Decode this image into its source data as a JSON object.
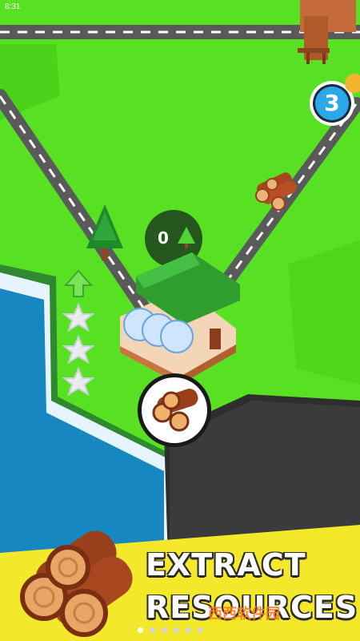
{
  "status_bar": {
    "time": "8:31"
  },
  "hud": {
    "level_badge": "3",
    "wood_counter": "0"
  },
  "promo_banner": {
    "line1": "EXTRACT",
    "line2": "RESOURCES"
  },
  "watermark": {
    "text": "西西软件园"
  },
  "pagination": {
    "total": 6,
    "active_index": 0
  },
  "colors": {
    "grass": "#58e022",
    "water": "#1787c2",
    "road": "#585858",
    "stone": "#3a3a3a",
    "badge": "#2aa8e8"
  },
  "icons": [
    "star-icon",
    "upgrade-arrow-icon",
    "log-icon",
    "tree-icon",
    "sawmill-icon",
    "logs-pile-icon"
  ]
}
